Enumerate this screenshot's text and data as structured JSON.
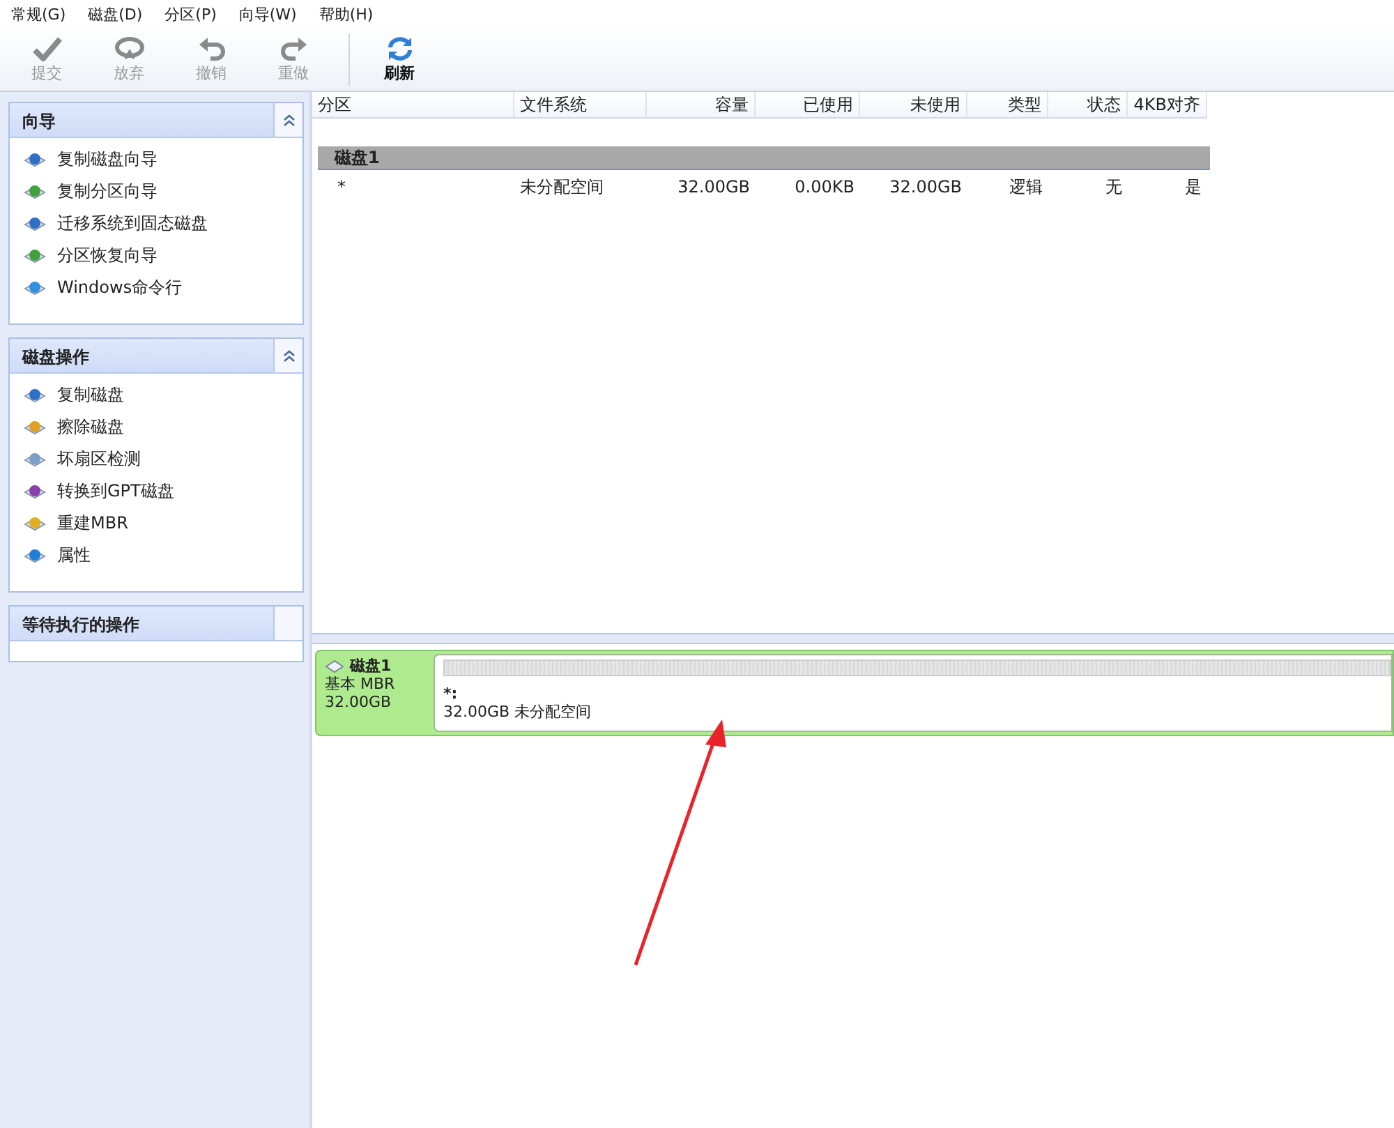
{
  "menu": [
    {
      "label": "常规(G)"
    },
    {
      "label": "磁盘(D)"
    },
    {
      "label": "分区(P)"
    },
    {
      "label": "向导(W)"
    },
    {
      "label": "帮助(H)"
    }
  ],
  "toolbar": [
    {
      "label": "提交",
      "kind": "check",
      "disabled": true
    },
    {
      "label": "放弃",
      "kind": "discard",
      "disabled": true
    },
    {
      "label": "撤销",
      "kind": "undo",
      "disabled": true
    },
    {
      "label": "重做",
      "kind": "redo",
      "disabled": true
    },
    {
      "label": "刷新",
      "kind": "refresh",
      "disabled": false
    }
  ],
  "sidebar": {
    "panels": [
      {
        "title": "向导",
        "expanded": true,
        "items": [
          {
            "label": "复制磁盘向导",
            "kind": "copy"
          },
          {
            "label": "复制分区向导",
            "kind": "partition"
          },
          {
            "label": "迁移系统到固态磁盘",
            "kind": "copy"
          },
          {
            "label": "分区恢复向导",
            "kind": "recover"
          },
          {
            "label": "Windows命令行",
            "kind": "windows"
          }
        ]
      },
      {
        "title": "磁盘操作",
        "expanded": true,
        "items": [
          {
            "label": "复制磁盘",
            "kind": "copy"
          },
          {
            "label": "擦除磁盘",
            "kind": "wipe"
          },
          {
            "label": "坏扇区检测",
            "kind": "scan"
          },
          {
            "label": "转换到GPT磁盘",
            "kind": "convert"
          },
          {
            "label": "重建MBR",
            "kind": "mbr"
          },
          {
            "label": "属性",
            "kind": "info"
          }
        ]
      },
      {
        "title": "等待执行的操作",
        "expanded": false
      }
    ]
  },
  "table": {
    "columns": [
      {
        "label": "分区"
      },
      {
        "label": "文件系统"
      },
      {
        "label": "容量"
      },
      {
        "label": "已使用"
      },
      {
        "label": "未使用"
      },
      {
        "label": "类型"
      },
      {
        "label": "状态"
      },
      {
        "label": "4KB对齐"
      }
    ],
    "groups": [
      {
        "title": "磁盘1",
        "rows": [
          [
            "*",
            "未分配空间",
            "32.00GB",
            "0.00KB",
            "32.00GB",
            "逻辑",
            "无",
            "是"
          ]
        ]
      }
    ]
  },
  "disk_map": [
    {
      "name": "磁盘1",
      "type": "基本 MBR",
      "size": "32.00GB",
      "partitions": [
        {
          "label": "*:",
          "detail": "32.00GB 未分配空间"
        }
      ]
    }
  ]
}
